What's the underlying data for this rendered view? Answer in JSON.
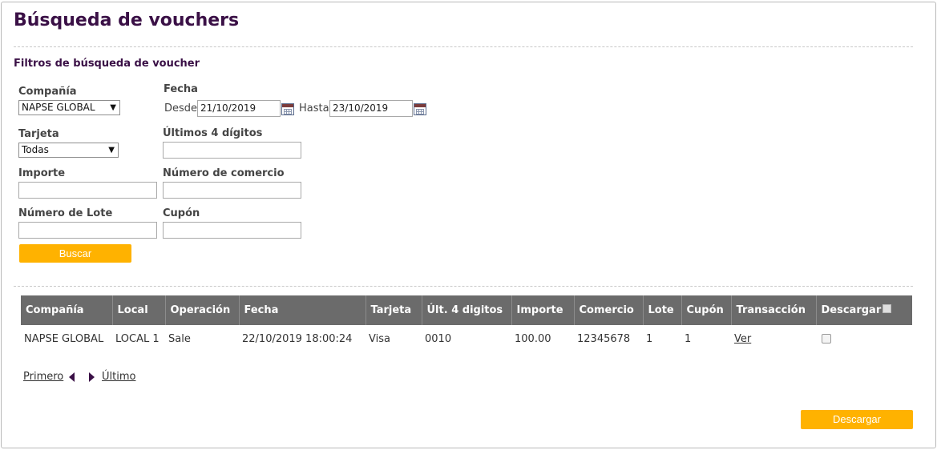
{
  "page": {
    "title": "Búsqueda de vouchers"
  },
  "filters": {
    "section_title": "Filtros de búsqueda de voucher",
    "company": {
      "label": "Compañía",
      "selected": "NAPSE GLOBAL"
    },
    "date": {
      "label": "Fecha",
      "from_label": "Desde",
      "from_value": "21/10/2019",
      "to_label": "Hasta",
      "to_value": "23/10/2019"
    },
    "card": {
      "label": "Tarjeta",
      "selected": "Todas"
    },
    "last4": {
      "label": "Últimos 4 dígitos",
      "value": ""
    },
    "amount": {
      "label": "Importe",
      "value": ""
    },
    "merchant": {
      "label": "Número de comercio",
      "value": ""
    },
    "batch": {
      "label": "Número de Lote",
      "value": ""
    },
    "coupon": {
      "label": "Cupón",
      "value": ""
    },
    "search_label": "Buscar"
  },
  "table": {
    "columns": [
      "Compañía",
      "Local",
      "Operación",
      "Fecha",
      "Tarjeta",
      "Últ. 4 digitos",
      "Importe",
      "Comercio",
      "Lote",
      "Cupón",
      "Transacción",
      "Descargar"
    ],
    "rows": [
      [
        "NAPSE GLOBAL",
        "LOCAL 1",
        "Sale",
        "22/10/2019 18:00:24",
        "Visa",
        "0010",
        "100.00",
        "12345678",
        "1",
        "1",
        "Ver",
        ""
      ]
    ]
  },
  "pager": {
    "first_label": "Primero",
    "last_label": "Último"
  },
  "actions": {
    "download_label": "Descargar"
  },
  "colors": {
    "accent": "#ffb200",
    "title": "#3a1046",
    "header_bg": "#6b6b6b"
  },
  "icons": [
    "calendar-icon",
    "prev-page-icon",
    "next-page-icon",
    "dropdown-arrow-icon"
  ]
}
